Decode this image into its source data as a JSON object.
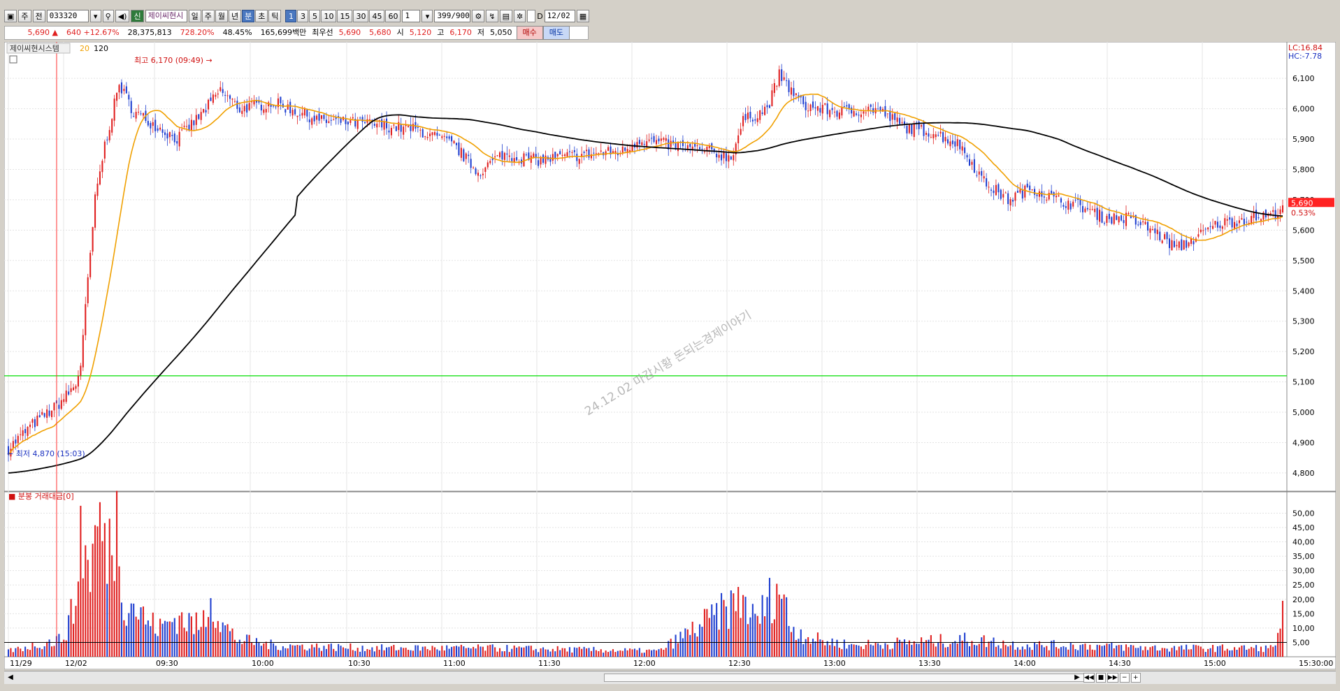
{
  "toolbar": {
    "mode_select": "주",
    "chart_type": "전",
    "stock_code": "033320",
    "search_icon": "search-icon",
    "sound_icon": "speaker-icon",
    "new_badge": "신",
    "stock_name": "제이씨현시",
    "periods": [
      "일",
      "주",
      "월",
      "년",
      "분",
      "초",
      "틱"
    ],
    "period_active": "분",
    "intervals": [
      "1",
      "3",
      "5",
      "10",
      "15",
      "30",
      "45",
      "60"
    ],
    "interval_active": "1",
    "interval_value": "1",
    "count": "399",
    "count_total": "/900",
    "date_label": "D",
    "date_value": "12/02"
  },
  "quote": {
    "price": "5,690",
    "arrow": "▲",
    "change": "640",
    "change_pct": "+12.67%",
    "volume": "28,375,813",
    "volume_ratio": "728.20%",
    "turnover": "48.45%",
    "amount": "165,699백만",
    "best_bid_label": "최우선",
    "best_bid": "5,690",
    "best_ask": "5,680",
    "open_label": "시",
    "open": "5,120",
    "high_label": "고",
    "high": "6,170",
    "low_label": "저",
    "low": "5,050",
    "buy_label": "매수",
    "sell_label": "매도"
  },
  "colors": {
    "up": "#e01e1e",
    "down": "#1f3fd0",
    "ma20": "#f0a000",
    "ma120": "#000000",
    "hline": "#00dd00",
    "price_tag": "#ff2222"
  },
  "chart_data": {
    "type": "candlestick",
    "legend": {
      "name": "제이씨현시스템",
      "ma1": "20",
      "ma2": "120"
    },
    "price_axis": {
      "ylim": [
        4740,
        6220
      ],
      "ticks": [
        "6,100",
        "6,000",
        "5,900",
        "5,800",
        "5,700",
        "5,600",
        "5,500",
        "5,400",
        "5,300",
        "5,200",
        "5,100",
        "5,000",
        "4,900",
        "4,800"
      ],
      "values": [
        6100,
        6000,
        5900,
        5800,
        5700,
        5600,
        5500,
        5400,
        5300,
        5200,
        5100,
        5000,
        4900,
        4800
      ]
    },
    "volume_panel": {
      "title": "분봉 거래대금[0]",
      "ticks": [
        "50,00",
        "45,00",
        "40,00",
        "35,00",
        "30,00",
        "25,00",
        "20,00",
        "15,00",
        "10,00",
        "5,00"
      ],
      "values": [
        50,
        45,
        40,
        35,
        30,
        25,
        20,
        15,
        10,
        5
      ],
      "ylim": [
        0,
        54
      ],
      "ref_line": 5
    },
    "x_labels": [
      "11/29",
      "12/02",
      "09:30",
      "10:00",
      "10:30",
      "11:00",
      "11:30",
      "12:00",
      "12:30",
      "13:00",
      "13:30",
      "14:00",
      "14:30",
      "15:00",
      "15:30:00"
    ],
    "annotations": {
      "high_text": "최고 6,170 (09:49)",
      "low_text": "최저 4,870 (15:03)",
      "lc": "LC:16.84",
      "hc": "HC:-7.78",
      "current_price": "5,690",
      "current_pct": "0.53%",
      "watermark": "24.12.02 마감시황 돈되는경제이야기"
    },
    "support_line": 5120,
    "price_keypoints": [
      [
        0,
        4880
      ],
      [
        10,
        4960
      ],
      [
        20,
        5020
      ],
      [
        28,
        5090
      ],
      [
        30,
        5160
      ],
      [
        36,
        5700
      ],
      [
        40,
        5880
      ],
      [
        46,
        6080
      ],
      [
        52,
        5990
      ],
      [
        60,
        5950
      ],
      [
        70,
        5900
      ],
      [
        80,
        5980
      ],
      [
        88,
        6060
      ],
      [
        96,
        6000
      ],
      [
        110,
        6020
      ],
      [
        130,
        5960
      ],
      [
        150,
        5950
      ],
      [
        170,
        5930
      ],
      [
        185,
        5880
      ],
      [
        195,
        5790
      ],
      [
        205,
        5850
      ],
      [
        220,
        5830
      ],
      [
        240,
        5850
      ],
      [
        255,
        5860
      ],
      [
        262,
        5900
      ],
      [
        275,
        5880
      ],
      [
        290,
        5860
      ],
      [
        300,
        5840
      ],
      [
        305,
        5960
      ],
      [
        315,
        6000
      ],
      [
        320,
        6110
      ],
      [
        330,
        6010
      ],
      [
        345,
        5990
      ],
      [
        360,
        6000
      ],
      [
        372,
        5940
      ],
      [
        385,
        5920
      ],
      [
        395,
        5880
      ],
      [
        405,
        5760
      ],
      [
        415,
        5700
      ],
      [
        425,
        5740
      ],
      [
        435,
        5700
      ],
      [
        445,
        5680
      ],
      [
        455,
        5640
      ],
      [
        465,
        5640
      ],
      [
        475,
        5600
      ],
      [
        485,
        5540
      ],
      [
        492,
        5570
      ],
      [
        502,
        5620
      ],
      [
        515,
        5640
      ],
      [
        525,
        5650
      ],
      [
        530,
        5690
      ]
    ],
    "volume_keypoints": [
      [
        0,
        2
      ],
      [
        22,
        6
      ],
      [
        28,
        18
      ],
      [
        30,
        45
      ],
      [
        33,
        30
      ],
      [
        36,
        38
      ],
      [
        38,
        50
      ],
      [
        40,
        35
      ],
      [
        45,
        47
      ],
      [
        48,
        20
      ],
      [
        52,
        18
      ],
      [
        58,
        12
      ],
      [
        63,
        10
      ],
      [
        70,
        14
      ],
      [
        80,
        10
      ],
      [
        84,
        22
      ],
      [
        88,
        12
      ],
      [
        95,
        6
      ],
      [
        110,
        4
      ],
      [
        150,
        3
      ],
      [
        200,
        3
      ],
      [
        270,
        2
      ],
      [
        305,
        20
      ],
      [
        310,
        12
      ],
      [
        320,
        25
      ],
      [
        325,
        10
      ],
      [
        335,
        6
      ],
      [
        350,
        4
      ],
      [
        400,
        6
      ],
      [
        420,
        4
      ],
      [
        440,
        4
      ],
      [
        480,
        3
      ],
      [
        525,
        3
      ],
      [
        529,
        14
      ]
    ]
  }
}
